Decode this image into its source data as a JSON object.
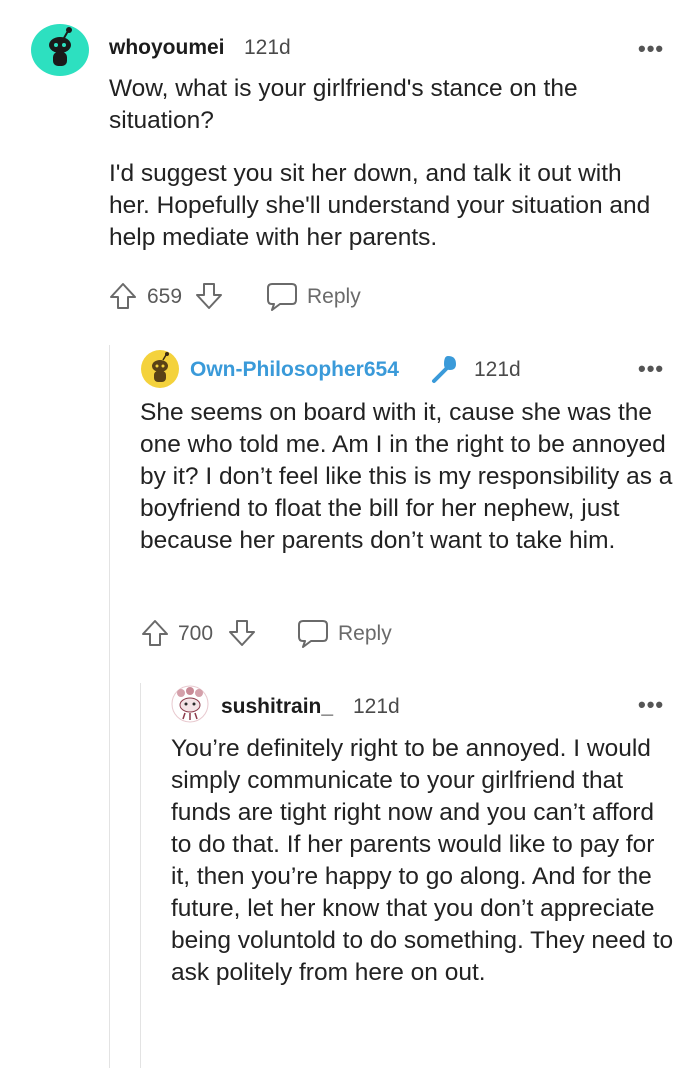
{
  "comments": [
    {
      "username": "whoyoumei",
      "age": "121d",
      "paragraphs": [
        "Wow, what is your girlfriend's stance on the situation?",
        "I'd suggest you sit her down, and talk it out with her. Hopefully she'll understand your situation and help mediate with her parents."
      ],
      "votes": "659",
      "reply_label": "Reply",
      "more_label": "•••",
      "avatar_color": "#2de0c0"
    },
    {
      "username": "Own-Philosopher654",
      "age": "121d",
      "is_op": true,
      "paragraphs": [
        "She seems on board with it, cause she was the one who told me. Am I in the right to be annoyed by it? I don’t feel like this is my responsibility as a boyfriend to float the bill for her nephew, just because her parents don’t want to take him."
      ],
      "votes": "700",
      "reply_label": "Reply",
      "more_label": "•••",
      "avatar_color": "#f4d23c"
    },
    {
      "username": "sushitrain_",
      "age": "121d",
      "paragraphs": [
        "You’re definitely right to be annoyed. I would simply communicate to your girlfriend that funds are tight right now and you can’t afford to do that. If her parents would like to pay for it, then you’re happy to go along. And for the future, let her know that you don’t appreciate being voluntold to do something. They need to ask politely from here on out."
      ],
      "more_label": "•••"
    }
  ],
  "icons": {
    "upvote": "upvote-arrow-icon",
    "downvote": "downvote-arrow-icon",
    "reply": "speech-bubble-icon",
    "op_badge": "microphone-icon"
  },
  "colors": {
    "op_accent": "#3a9ad9",
    "thread_line": "#e3e3e3"
  }
}
